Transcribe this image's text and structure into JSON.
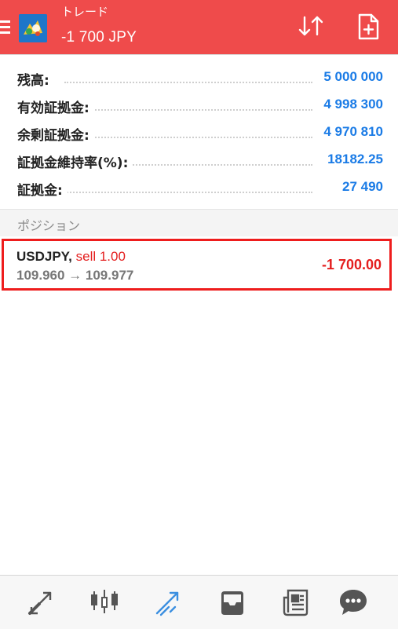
{
  "header": {
    "title": "トレード",
    "balance_change": "-1 700 JPY",
    "menu_icon": "hamburger-menu-icon",
    "logo_icon": "metatrader-logo-icon",
    "sort_icon": "sort-arrows-icon",
    "new_order_icon": "new-order-icon",
    "background_color": "#ef4b4b"
  },
  "account": [
    {
      "label": "残高:",
      "value": "5 000 000"
    },
    {
      "label": "有効証拠金:",
      "value": "4 998 300"
    },
    {
      "label": "余剰証拠金:",
      "value": "4 970 810"
    },
    {
      "label": "証拠金維持率(%):",
      "value": "18182.25"
    },
    {
      "label": "証拠金:",
      "value": "27 490"
    }
  ],
  "positions_section": {
    "title": "ポジション"
  },
  "positions": [
    {
      "symbol": "USDJPY,",
      "side": "sell 1.00",
      "prices": "109.960 → 109.977",
      "profit": "-1 700.00"
    }
  ],
  "bottom_nav": [
    {
      "icon": "quotes-icon",
      "active": false
    },
    {
      "icon": "chart-icon",
      "active": false
    },
    {
      "icon": "trade-icon",
      "active": true
    },
    {
      "icon": "history-icon",
      "active": false
    },
    {
      "icon": "news-icon",
      "active": false
    },
    {
      "icon": "messages-icon",
      "active": false
    }
  ],
  "colors": {
    "accent_blue": "#1a7be6",
    "loss_red": "#e41e1e",
    "highlight_border": "#ee1d1d",
    "nav_icon": "#555555",
    "nav_active": "#3b8fe0"
  }
}
